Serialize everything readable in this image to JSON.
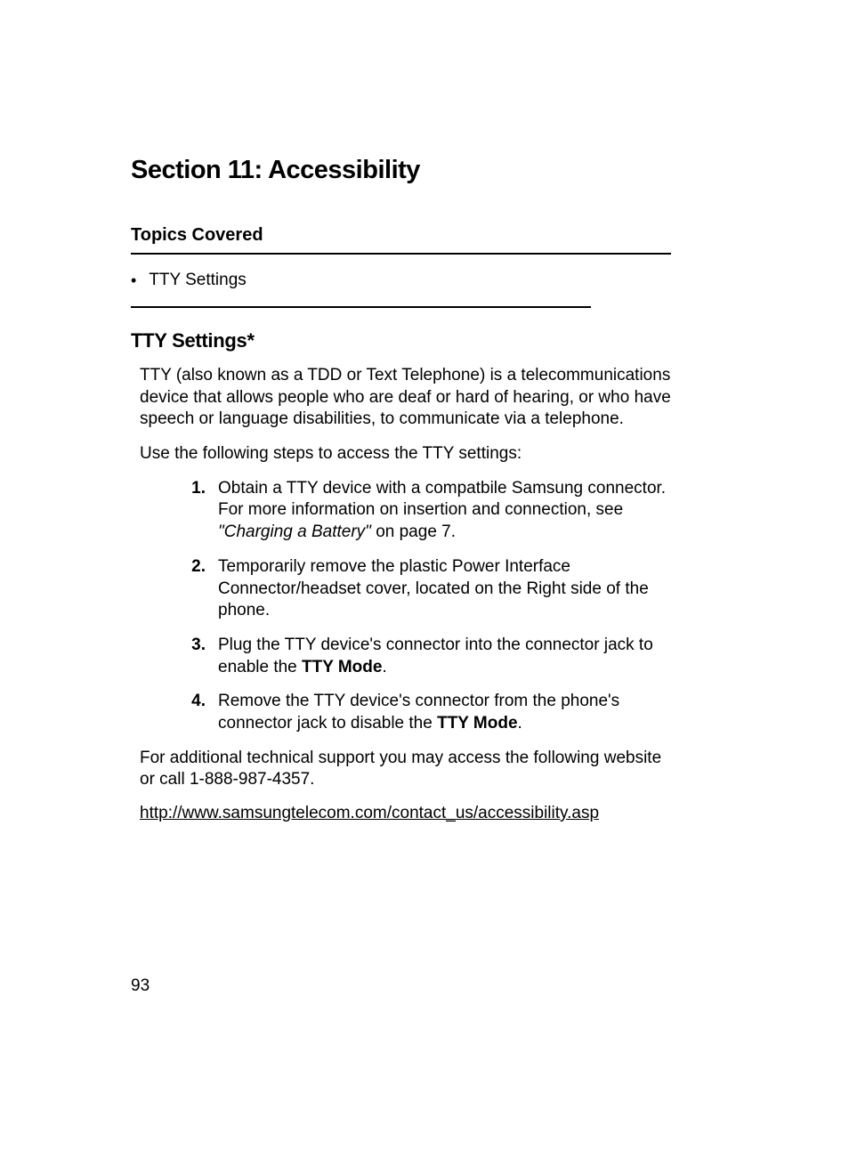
{
  "section_title": "Section 11: Accessibility",
  "topics_header": "Topics Covered",
  "bullet_item": "TTY Settings",
  "subheading": "TTY Settings*",
  "para1": "TTY (also known as a TDD or Text Telephone) is a telecommunications device that allows people who are deaf or hard of hearing, or who have speech or language disabilities, to communicate via a telephone.",
  "para2": "Use the following steps to access the TTY settings:",
  "steps": [
    {
      "num": "1.",
      "text_before": "Obtain a TTY device with a compatbile Samsung connector. For more information on insertion and connection, see ",
      "italic": "\"Charging a Battery\"",
      "text_after": "  on page 7."
    },
    {
      "num": "2.",
      "text_before": "Temporarily remove the plastic Power Interface Connector/headset cover, located on the Right side of the phone.",
      "italic": "",
      "text_after": ""
    },
    {
      "num": "3.",
      "text_before": "Plug the TTY device's connector into the connector jack to enable the ",
      "bold": "TTY Mode",
      "text_after": "."
    },
    {
      "num": "4.",
      "text_before": "Remove the TTY device's connector from the phone's connector jack to disable the ",
      "bold": "TTY Mode",
      "text_after": "."
    }
  ],
  "para3": "For additional technical support you may access the following website or call 1-888-987-4357.",
  "link": "http://www.samsungtelecom.com/contact_us/accessibility.asp",
  "page_num": "93"
}
